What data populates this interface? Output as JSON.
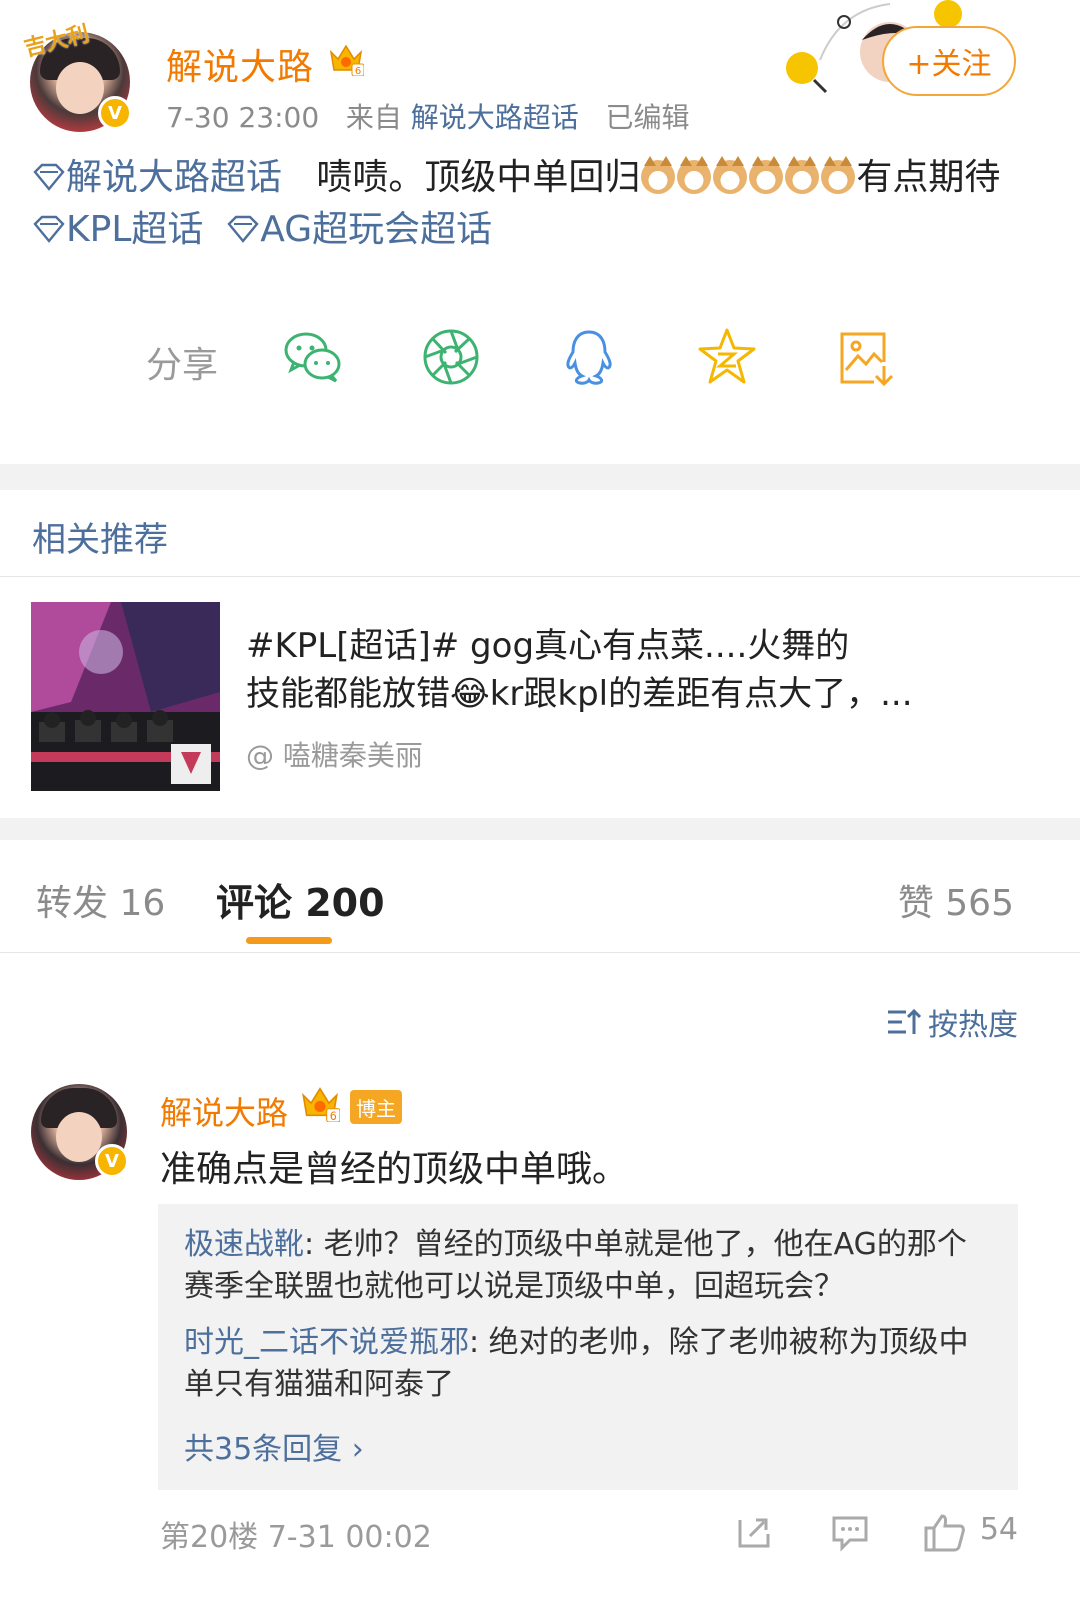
{
  "header": {
    "username": "解说大路",
    "avatar_sticker": "吉大利",
    "verified_mark": "V",
    "crown_level": "6",
    "meta_time": "7-30 23:00",
    "meta_from_label": "来自",
    "meta_source": "解说大路超话",
    "meta_edited": "已编辑",
    "follow_label": "+关注"
  },
  "post": {
    "topic1": "解说大路超话",
    "text1": "啧啧。顶级中单回归",
    "text2": "有点期待",
    "topic2": "KPL超话",
    "topic3": "AG超玩会超话"
  },
  "share": {
    "label": "分享",
    "targets": [
      "wechat-icon",
      "moments-icon",
      "qq-icon",
      "qzone-icon",
      "save-image-icon"
    ]
  },
  "related": {
    "title": "相关推荐",
    "line1": "#KPL[超话]# gog真心有点菜....火舞的",
    "line2": "技能都能放错😂kr跟kpl的差距有点大了，...",
    "author": "@ 嗑糖秦美丽"
  },
  "tabs": {
    "repost": "转发 16",
    "comments": "评论 200",
    "likes": "赞 565"
  },
  "sort_label": "按热度",
  "comment": {
    "username": "解说大路",
    "crown_level": "6",
    "host_tag": "博主",
    "verified_mark": "V",
    "text": "准确点是曾经的顶级中单哦。",
    "replies": [
      {
        "who": "极速战靴",
        "text": ": 老帅？曾经的顶级中单就是他了，他在AG的那个赛季全联盟也就他可以说是顶级中单，回超玩会？"
      },
      {
        "who": "时光_二话不说爱瓶邪",
        "text": ": 绝对的老帅，除了老帅被称为顶级中单只有猫猫和阿泰了"
      }
    ],
    "more_replies": "共35条回复 ›",
    "footer": "第20楼  7-31 00:02",
    "like_count": "54"
  },
  "colors": {
    "brand_orange": "#f27a00",
    "link_blue": "#4d6f9c",
    "tab_underline": "#f39a1a"
  }
}
